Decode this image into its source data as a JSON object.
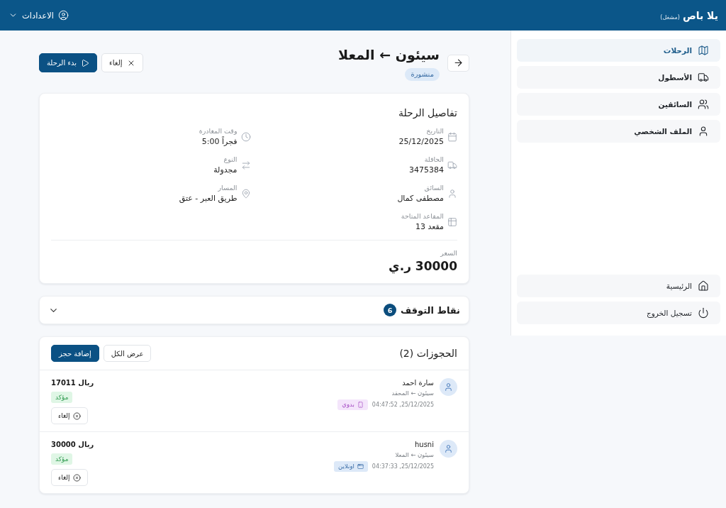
{
  "header": {
    "app_name": "يلا باص",
    "role": "(مشغل)",
    "settings_label": "الاعدادات"
  },
  "sidebar": {
    "items": [
      {
        "label": "الرحلات",
        "selected": true
      },
      {
        "label": "الأسطول",
        "selected": false
      },
      {
        "label": "السائقين",
        "selected": false
      },
      {
        "label": "الملف الشخصي",
        "selected": false
      }
    ],
    "footer_items": [
      {
        "label": "الرئيسية",
        "selected": false
      },
      {
        "label": "تسجيل الخروج",
        "selected": false
      }
    ]
  },
  "trip": {
    "title": "سيئون ← المعلا",
    "status": "منشورة",
    "actions": [
      {
        "label": "إلغاء",
        "kind": "cancel"
      },
      {
        "label": "بدء الرحلة",
        "kind": "start"
      }
    ]
  },
  "details": {
    "title": "تفاصيل الرحلة",
    "fields": [
      {
        "label": "التاريخ",
        "value": "25/12/2025"
      },
      {
        "label": "وقت المغادرة",
        "value": "فجراً 5:00"
      },
      {
        "label": "الحافلة",
        "value": "3475384"
      },
      {
        "label": "النوع",
        "value": "مجدولة"
      },
      {
        "label": "السائق",
        "value": "مصطفى كمال"
      },
      {
        "label": "المسار",
        "value": "طريق العبر - عتق"
      },
      {
        "label": "المقاعد المتاحة",
        "value": "مقعد 13"
      }
    ],
    "price_label": "السعر",
    "price": "30000 ر.ي"
  },
  "stops": {
    "title": "نقاط التوقف",
    "count": "6",
    "expanded": false
  },
  "bookings": {
    "title": "الحجوزات (2)",
    "actions": [
      {
        "label": "عرض الكل",
        "kind": "view_all"
      },
      {
        "label": "إضافة حجز",
        "kind": "add"
      }
    ],
    "rows": [
      {
        "name": "سارة احمد",
        "route": "سيئون ← المحقد",
        "time": "25/12/2025, 04:47:52",
        "source": {
          "label": "بدوي",
          "kind": "manual"
        },
        "amount": "ريال 17011",
        "status": "مؤكد",
        "cancel_label": "إلغاء"
      },
      {
        "name": "husni",
        "route": "سيئون ← المعلا",
        "time": "25/12/2025, 04:37:33",
        "source": {
          "label": "اونلاين",
          "kind": "online"
        },
        "amount": "ريال 30000",
        "status": "مؤكد",
        "cancel_label": "إلغاء"
      }
    ]
  }
}
